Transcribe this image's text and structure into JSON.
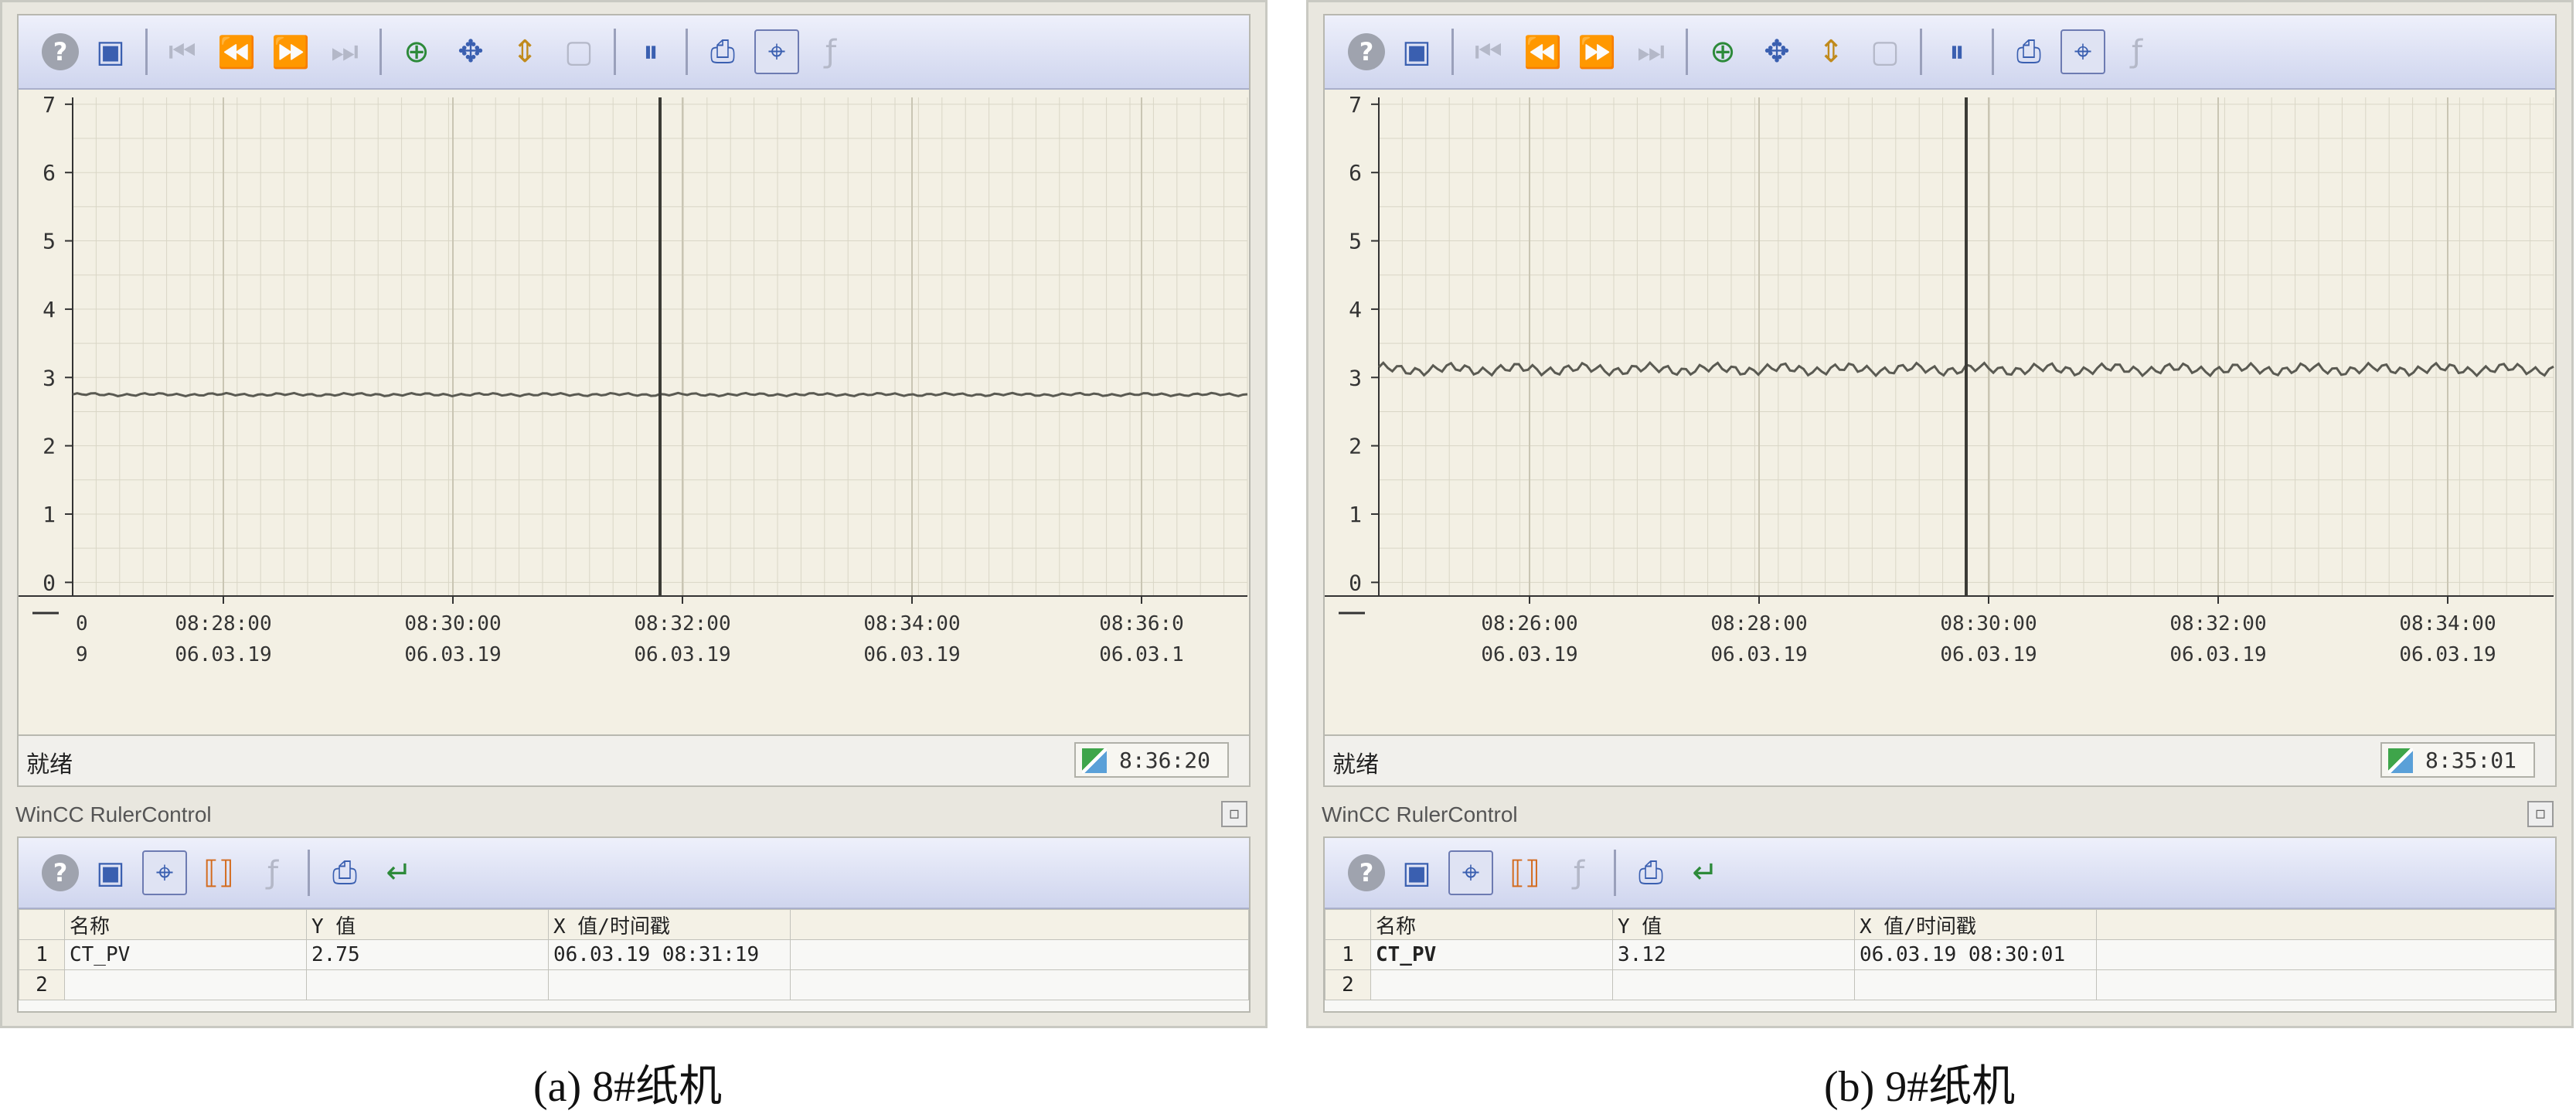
{
  "panels": [
    {
      "trend": {
        "y_ticks": [
          "7",
          "6",
          "5",
          "4",
          "3",
          "2",
          "1",
          "0"
        ],
        "x_ticks": [
          {
            "time": "08:28:00",
            "date": "06.03.19"
          },
          {
            "time": "08:30:00",
            "date": "06.03.19"
          },
          {
            "time": "08:32:00",
            "date": "06.03.19"
          },
          {
            "time": "08:34:00",
            "date": "06.03.19"
          },
          {
            "time": "08:36:0",
            "date": "06.03.1"
          }
        ],
        "x_edge_label": {
          "time": "0",
          "date": "9"
        },
        "status_text": "就绪",
        "status_time": "8:36:20",
        "series_level": 2.75,
        "series_noise": 0.015,
        "ruler_position": 0.5
      },
      "ruler": {
        "title": "WinCC RulerControl",
        "headers": [
          "名称",
          "Y 值",
          "X 值/时间戳"
        ],
        "rows": [
          {
            "index": "1",
            "name": "CT_PV",
            "y": "2.75",
            "x": "06.03.19 08:31:19"
          },
          {
            "index": "2",
            "name": "",
            "y": "",
            "x": ""
          }
        ]
      },
      "caption": "(a)  8#纸机"
    },
    {
      "trend": {
        "y_ticks": [
          "7",
          "6",
          "5",
          "4",
          "3",
          "2",
          "1",
          "0"
        ],
        "x_ticks": [
          {
            "time": "08:26:00",
            "date": "06.03.19"
          },
          {
            "time": "08:28:00",
            "date": "06.03.19"
          },
          {
            "time": "08:30:00",
            "date": "06.03.19"
          },
          {
            "time": "08:32:00",
            "date": "06.03.19"
          },
          {
            "time": "08:34:00",
            "date": "06.03.19"
          }
        ],
        "x_edge_label": {
          "time": "",
          "date": ""
        },
        "status_text": "就绪",
        "status_time": "8:35:01",
        "series_level": 3.12,
        "series_noise": 0.06,
        "ruler_position": 0.5
      },
      "ruler": {
        "title": "WinCC RulerControl",
        "headers": [
          "名称",
          "Y 值",
          "X 值/时间戳"
        ],
        "rows": [
          {
            "index": "1",
            "name": "CT_PV",
            "y": "3.12",
            "x": "06.03.19 08:30:01"
          },
          {
            "index": "2",
            "name": "",
            "y": "",
            "x": ""
          }
        ]
      },
      "caption": "(b) 9#纸机"
    }
  ],
  "colors": {
    "plot_bg": "#f3f0e4",
    "grid": "#d9d6c6",
    "series": "#5a5a52",
    "ruler": "#3b3b36"
  },
  "toolbar_icons": {
    "trend": [
      "help-icon",
      "config-icon",
      "first-page-icon",
      "prev-icon",
      "next-icon",
      "last-page-icon",
      "zoom-icon",
      "move-icon",
      "axis-icon",
      "original-view-icon",
      "stop-icon",
      "print-icon",
      "ruler-icon",
      "stats-icon"
    ],
    "ruler": [
      "help-icon",
      "config-icon",
      "ruler-icon",
      "range-icon",
      "stats-icon",
      "print-icon",
      "export-icon"
    ]
  }
}
